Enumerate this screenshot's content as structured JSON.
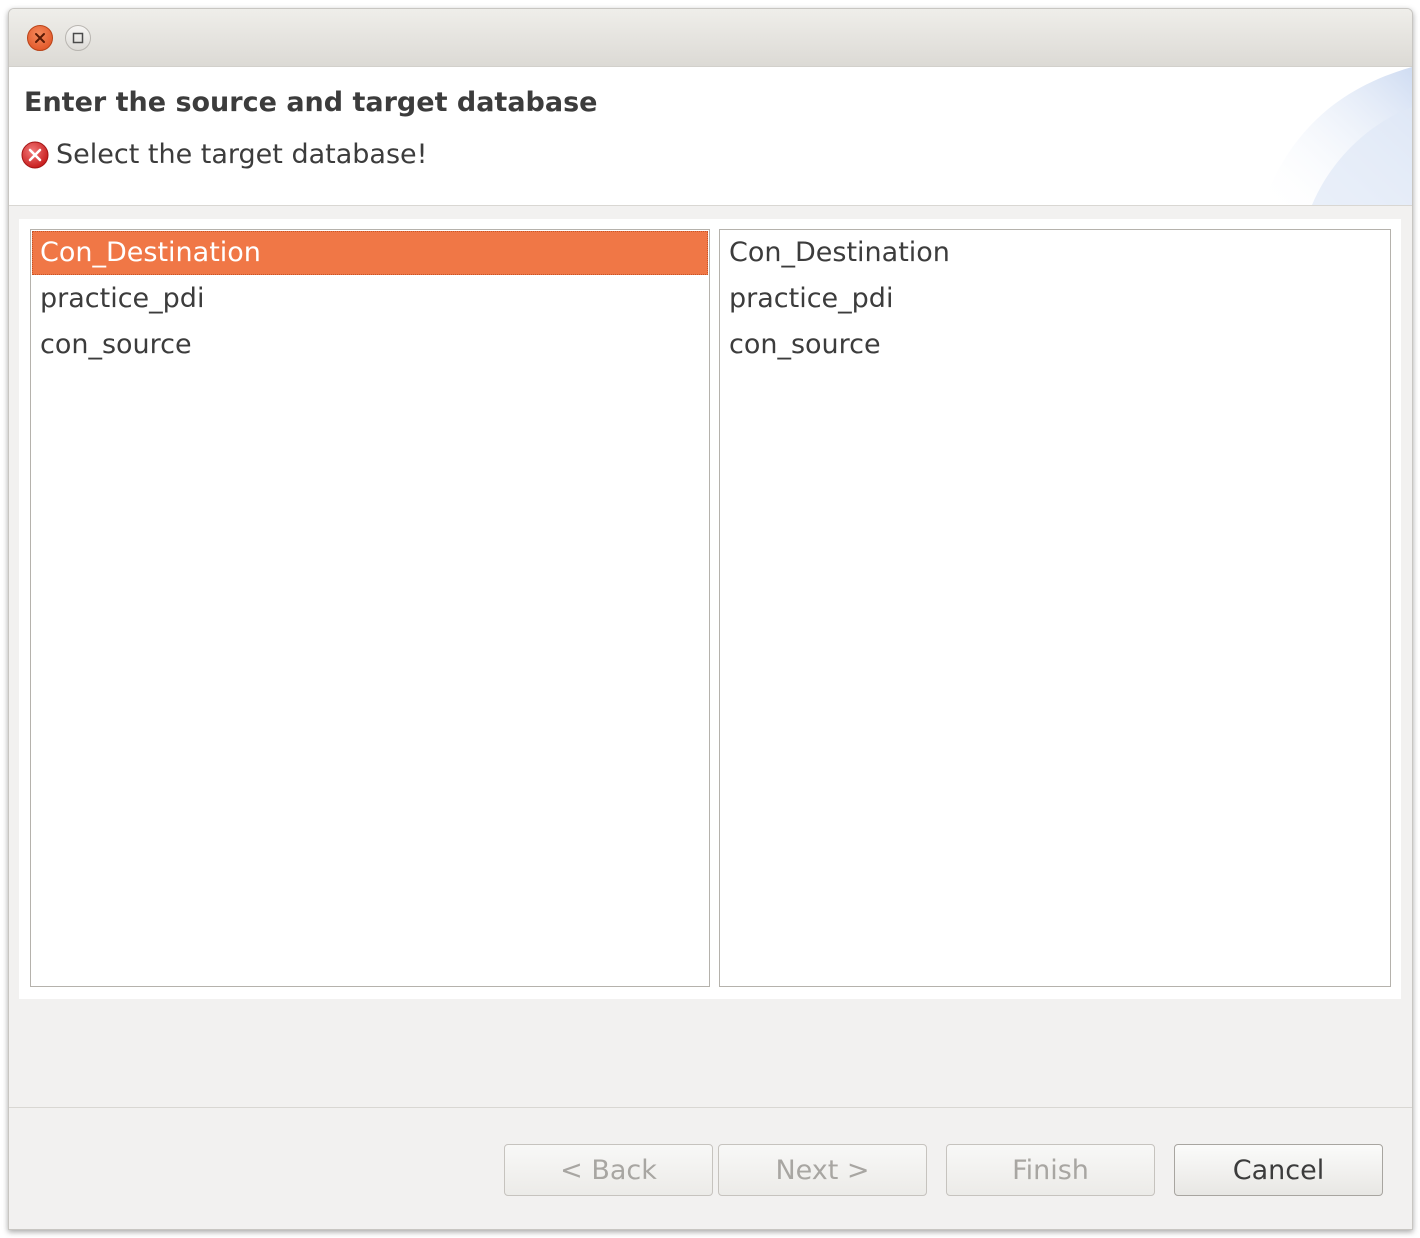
{
  "window": {
    "close_icon": "close-icon",
    "maximize_icon": "maximize-icon"
  },
  "header": {
    "title": "Enter the source and target database",
    "message": "Select the target database!",
    "message_icon": "error-icon"
  },
  "source_list": {
    "items": [
      "Con_Destination",
      "practice_pdi",
      "con_source"
    ],
    "selected": "Con_Destination"
  },
  "target_list": {
    "items": [
      "Con_Destination",
      "practice_pdi",
      "con_source"
    ],
    "selected": null
  },
  "buttons": {
    "back": "< Back",
    "next": "Next >",
    "finish": "Finish",
    "cancel": "Cancel"
  },
  "colors": {
    "selection": "#f07746",
    "error": "#dc3c3c"
  }
}
